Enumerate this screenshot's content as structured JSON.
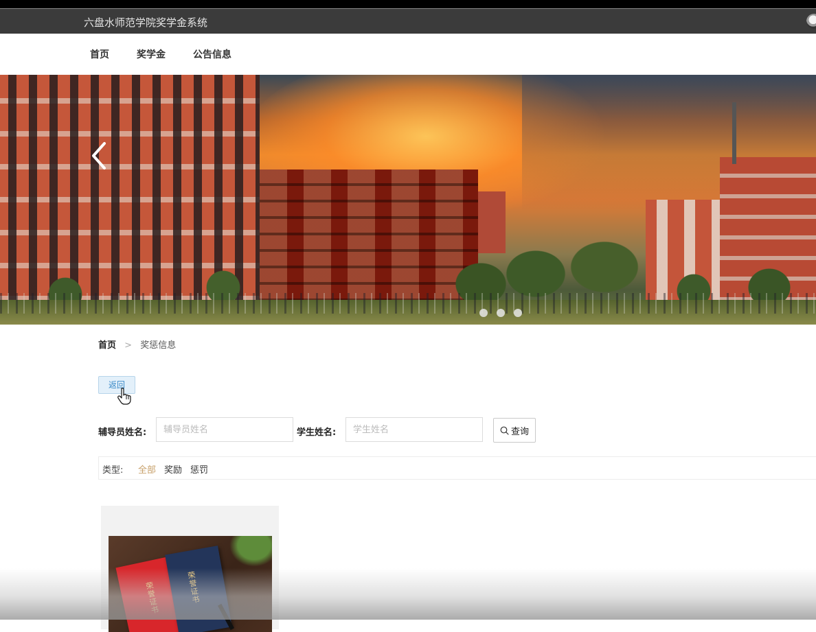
{
  "header": {
    "site_title": "六盘水师范学院奖学金系统"
  },
  "nav": {
    "items": [
      "首页",
      "奖学金",
      "公告信息"
    ]
  },
  "banner": {
    "slide_count": 3
  },
  "breadcrumb": {
    "home": "首页",
    "separator": ">",
    "current": "奖惩信息"
  },
  "actions": {
    "back_label": "返回"
  },
  "search": {
    "counselor_label": "辅导员姓名:",
    "counselor_placeholder": "辅导员姓名",
    "student_label": "学生姓名:",
    "student_placeholder": "学生姓名",
    "button_label": "查询"
  },
  "filter": {
    "label": "类型:",
    "options": [
      "全部",
      "奖励",
      "惩罚"
    ],
    "active": "全部",
    "active_color": "#c7a06a"
  },
  "card": {
    "book_titles": [
      "荣誉证书",
      "荣誉证书"
    ]
  },
  "colors": {
    "topbar": "#3b3b3b",
    "link_blue": "#3a8ac8"
  }
}
